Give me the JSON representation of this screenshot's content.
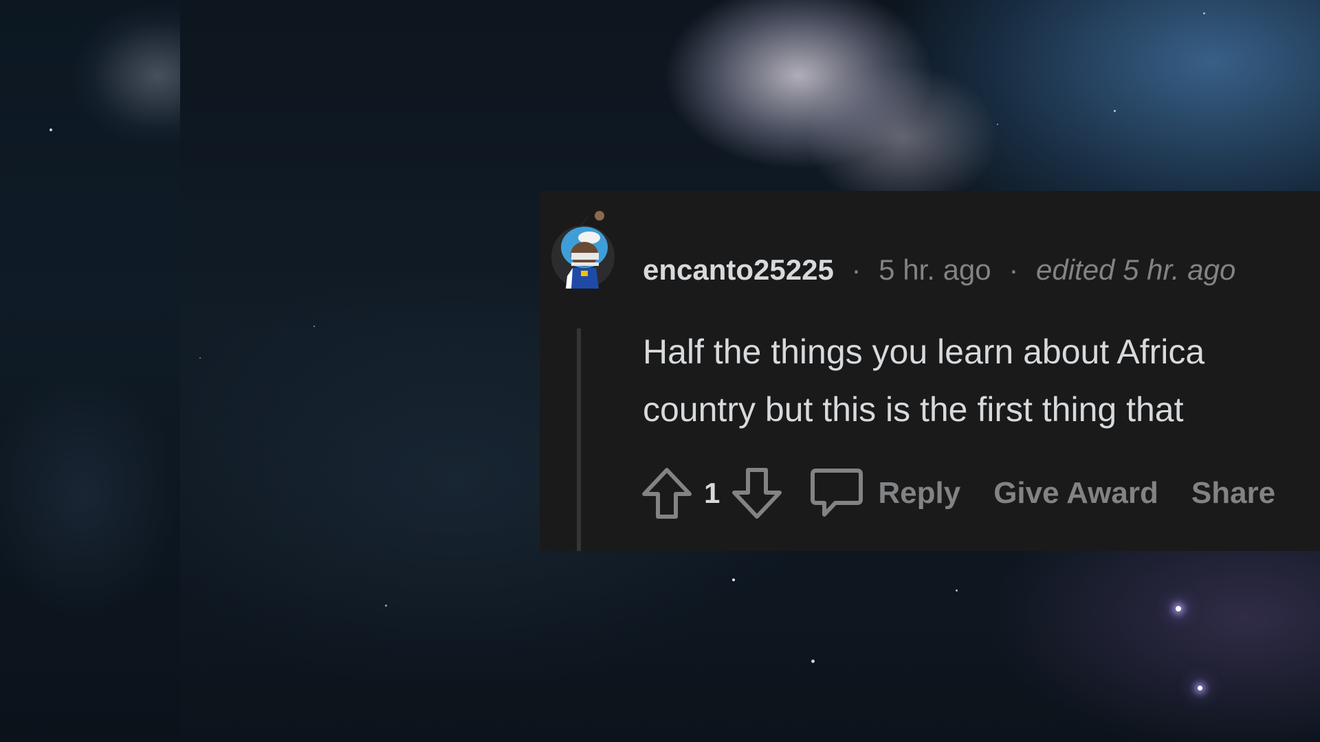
{
  "comment": {
    "username": "encanto25225",
    "separator": "·",
    "timestamp": "5 hr. ago",
    "edited": "edited 5 hr. ago",
    "body_lines": [
      "Half the things you learn about Africa",
      "country but this is the first thing that"
    ],
    "vote_count": "1",
    "actions": {
      "reply": "Reply",
      "give_award": "Give Award",
      "share": "Share"
    },
    "icons": {
      "upvote": "arrow-up-icon",
      "downvote": "arrow-down-icon",
      "reply": "speech-bubble-icon",
      "avatar": "user-avatar"
    }
  },
  "colors": {
    "card_bg": "#1a1a1b",
    "text_primary": "#d7dadc",
    "text_secondary": "#818384",
    "thread_line": "#343536"
  }
}
